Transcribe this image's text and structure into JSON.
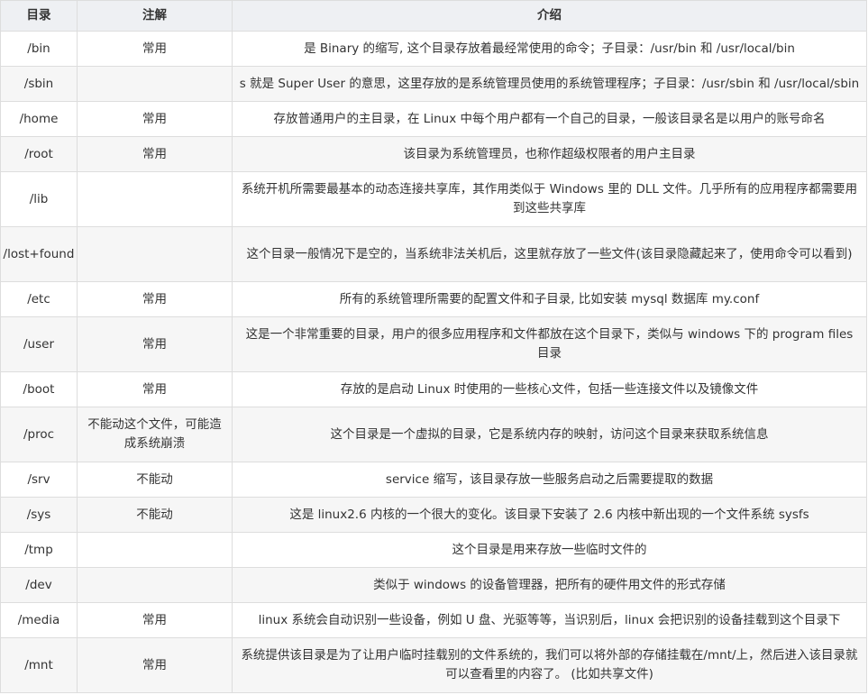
{
  "table": {
    "headers": [
      "目录",
      "注解",
      "介绍"
    ],
    "rows": [
      {
        "dir": "/bin",
        "note": "常用",
        "desc": "是 Binary 的缩写, 这个目录存放着最经常使用的命令；子目录：/usr/bin 和 /usr/local/bin"
      },
      {
        "dir": "/sbin",
        "note": "",
        "desc": "s 就是 Super User 的意思，这里存放的是系统管理员使用的系统管理程序；子目录：/usr/sbin 和 /usr/local/sbin"
      },
      {
        "dir": "/home",
        "note": "常用",
        "desc": "存放普通用户的主目录，在 Linux 中每个用户都有一个自己的目录，一般该目录名是以用户的账号命名"
      },
      {
        "dir": "/root",
        "note": "常用",
        "desc": "该目录为系统管理员，也称作超级权限者的用户主目录"
      },
      {
        "dir": "/lib",
        "note": "",
        "desc": "系统开机所需要最基本的动态连接共享库，其作用类似于 Windows 里的 DLL 文件。几乎所有的应用程序都需要用到这些共享库"
      },
      {
        "dir": "/lost+found",
        "note": "",
        "desc": "这个目录一般情况下是空的，当系统非法关机后，这里就存放了一些文件(该目录隐藏起来了，使用命令可以看到)"
      },
      {
        "dir": "/etc",
        "note": "常用",
        "desc": "所有的系统管理所需要的配置文件和子目录, 比如安装 mysql 数据库 my.conf"
      },
      {
        "dir": "/user",
        "note": "常用",
        "desc": "这是一个非常重要的目录，用户的很多应用程序和文件都放在这个目录下，类似与 windows 下的 program files 目录"
      },
      {
        "dir": "/boot",
        "note": "常用",
        "desc": "存放的是启动 Linux 时使用的一些核心文件，包括一些连接文件以及镜像文件"
      },
      {
        "dir": "/proc",
        "note": "不能动这个文件，可能造成系统崩溃",
        "desc": "这个目录是一个虚拟的目录，它是系统内存的映射，访问这个目录来获取系统信息"
      },
      {
        "dir": "/srv",
        "note": "不能动",
        "desc": "service 缩写，该目录存放一些服务启动之后需要提取的数据"
      },
      {
        "dir": "/sys",
        "note": "不能动",
        "desc": "这是 linux2.6 内核的一个很大的变化。该目录下安装了 2.6 内核中新出现的一个文件系统 sysfs"
      },
      {
        "dir": "/tmp",
        "note": "",
        "desc": "这个目录是用来存放一些临时文件的"
      },
      {
        "dir": "/dev",
        "note": "",
        "desc": "类似于 windows 的设备管理器，把所有的硬件用文件的形式存储"
      },
      {
        "dir": "/media",
        "note": "常用",
        "desc": "linux 系统会自动识别一些设备，例如 U 盘、光驱等等，当识别后，linux 会把识别的设备挂载到这个目录下"
      },
      {
        "dir": "/mnt",
        "note": "常用",
        "desc": "系统提供该目录是为了让用户临时挂载别的文件系统的，我们可以将外部的存储挂载在/mnt/上，然后进入该目录就可以查看里的内容了。 (比如共享文件)"
      }
    ]
  }
}
